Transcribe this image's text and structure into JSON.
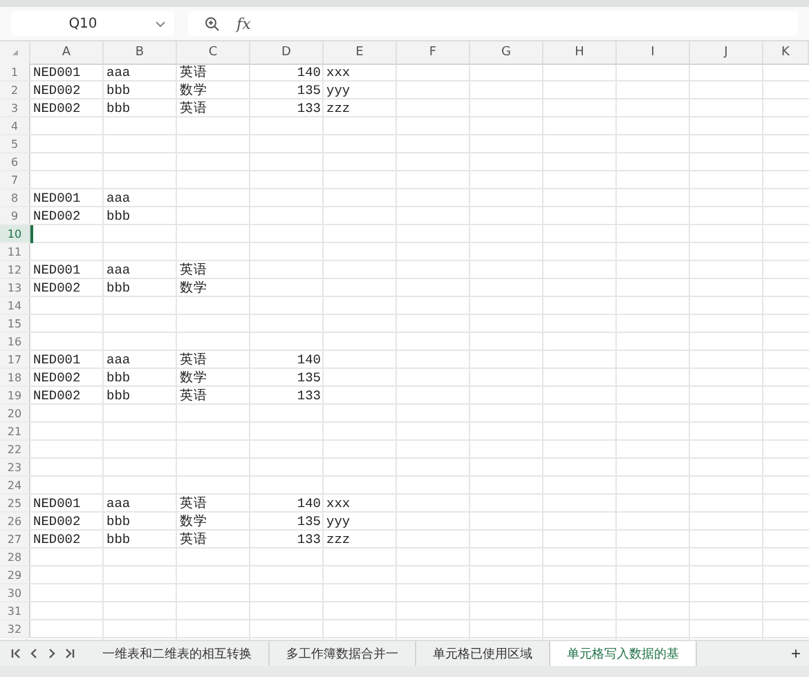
{
  "formula_bar": {
    "name_box": "Q10",
    "fx": "fx"
  },
  "columns": [
    "A",
    "B",
    "C",
    "D",
    "E",
    "F",
    "G",
    "H",
    "I",
    "J",
    "K"
  ],
  "rows": [
    {
      "number": "1",
      "selected": false,
      "cells": [
        "NED001",
        "aaa",
        "英语",
        "140",
        "xxx"
      ]
    },
    {
      "number": "2",
      "selected": false,
      "cells": [
        "NED002",
        "bbb",
        "数学",
        "135",
        "yyy"
      ]
    },
    {
      "number": "3",
      "selected": false,
      "cells": [
        "NED002",
        "bbb",
        "英语",
        "133",
        "zzz"
      ]
    },
    {
      "number": "4",
      "selected": false
    },
    {
      "number": "5",
      "selected": false
    },
    {
      "number": "6",
      "selected": false
    },
    {
      "number": "7",
      "selected": false
    },
    {
      "number": "8",
      "selected": false,
      "cells": [
        "NED001",
        "aaa"
      ]
    },
    {
      "number": "9",
      "selected": false,
      "cells": [
        "NED002",
        "bbb"
      ]
    },
    {
      "number": "10",
      "selected": true
    },
    {
      "number": "11",
      "selected": false
    },
    {
      "number": "12",
      "selected": false,
      "cells": [
        "NED001",
        "aaa",
        "英语"
      ]
    },
    {
      "number": "13",
      "selected": false,
      "cells": [
        "NED002",
        "bbb",
        "数学"
      ]
    },
    {
      "number": "14",
      "selected": false
    },
    {
      "number": "15",
      "selected": false
    },
    {
      "number": "16",
      "selected": false
    },
    {
      "number": "17",
      "selected": false,
      "cells": [
        "NED001",
        "aaa",
        "英语",
        "140"
      ]
    },
    {
      "number": "18",
      "selected": false,
      "cells": [
        "NED002",
        "bbb",
        "数学",
        "135"
      ]
    },
    {
      "number": "19",
      "selected": false,
      "cells": [
        "NED002",
        "bbb",
        "英语",
        "133"
      ]
    },
    {
      "number": "20",
      "selected": false
    },
    {
      "number": "21",
      "selected": false
    },
    {
      "number": "22",
      "selected": false
    },
    {
      "number": "23",
      "selected": false
    },
    {
      "number": "24",
      "selected": false
    },
    {
      "number": "25",
      "selected": false,
      "cells": [
        "NED001",
        "aaa",
        "英语",
        "140",
        "xxx"
      ]
    },
    {
      "number": "26",
      "selected": false,
      "cells": [
        "NED002",
        "bbb",
        "数学",
        "135",
        "yyy"
      ]
    },
    {
      "number": "27",
      "selected": false,
      "cells": [
        "NED002",
        "bbb",
        "英语",
        "133",
        "zzz"
      ]
    },
    {
      "number": "28",
      "selected": false
    },
    {
      "number": "29",
      "selected": false
    },
    {
      "number": "30",
      "selected": false
    },
    {
      "number": "31",
      "selected": false
    },
    {
      "number": "32",
      "selected": false
    }
  ],
  "sheet_tabs": [
    {
      "label": "一维表和二维表的相互转换",
      "selected": false
    },
    {
      "label": "多工作簿数据合并一",
      "selected": false
    },
    {
      "label": "单元格已使用区域",
      "selected": false
    },
    {
      "label": "单元格写入数据的基",
      "selected": true
    }
  ],
  "add_sheet": "+"
}
